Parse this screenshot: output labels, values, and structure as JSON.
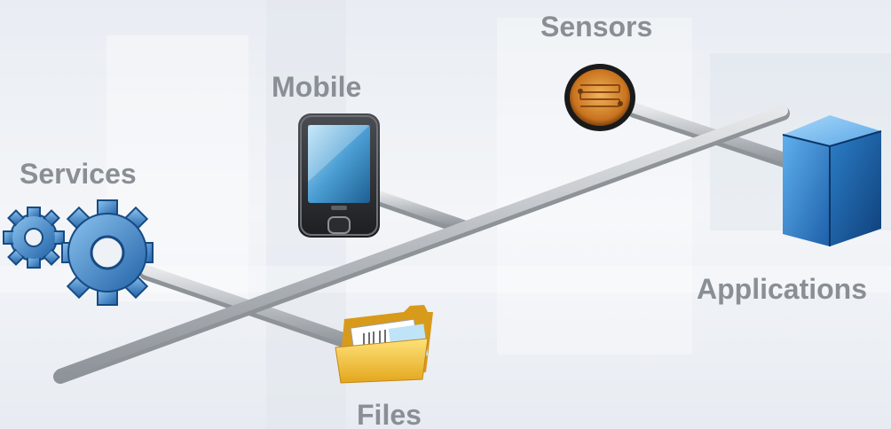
{
  "labels": {
    "sensors": "Sensors",
    "mobile": "Mobile",
    "services": "Services",
    "applications": "Applications",
    "files": "Files"
  },
  "icons": {
    "sensors": "light-sensor-icon",
    "mobile": "smartphone-icon",
    "services": "gears-icon",
    "applications": "cube-server-icon",
    "files": "folder-icon"
  },
  "colors": {
    "label": "#8a8f95",
    "pipe": "#c4c7cb",
    "cube": "#2b7fc9",
    "gear": "#3d86cc",
    "folder": "#f4c542",
    "sensor": "#d98a2a"
  }
}
